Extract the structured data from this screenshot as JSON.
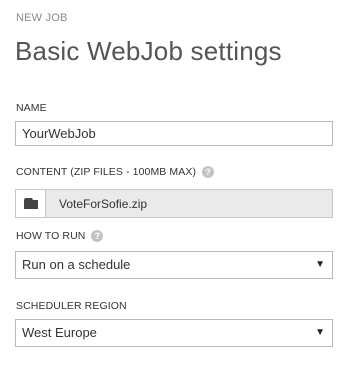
{
  "header": {
    "eyebrow": "NEW JOB",
    "title": "Basic WebJob settings"
  },
  "fields": {
    "name": {
      "label": "NAME",
      "value": "YourWebJob"
    },
    "content": {
      "label": "CONTENT (ZIP FILES - 100MB MAX)",
      "file_name": "VoteForSofie.zip",
      "help_icon": "help-icon",
      "button_icon": "folder-icon"
    },
    "how_to_run": {
      "label": "HOW TO RUN",
      "selected": "Run on a schedule",
      "help_icon": "help-icon"
    },
    "scheduler_region": {
      "label": "SCHEDULER REGION",
      "selected": "West Europe"
    }
  },
  "colors": {
    "label_text": "#333333",
    "eyebrow_text": "#8a8a8a",
    "title_text": "#555555",
    "input_border": "#b9b9b9",
    "file_field_bg": "#eaeaea",
    "help_icon_bg": "#c4c4c4"
  }
}
